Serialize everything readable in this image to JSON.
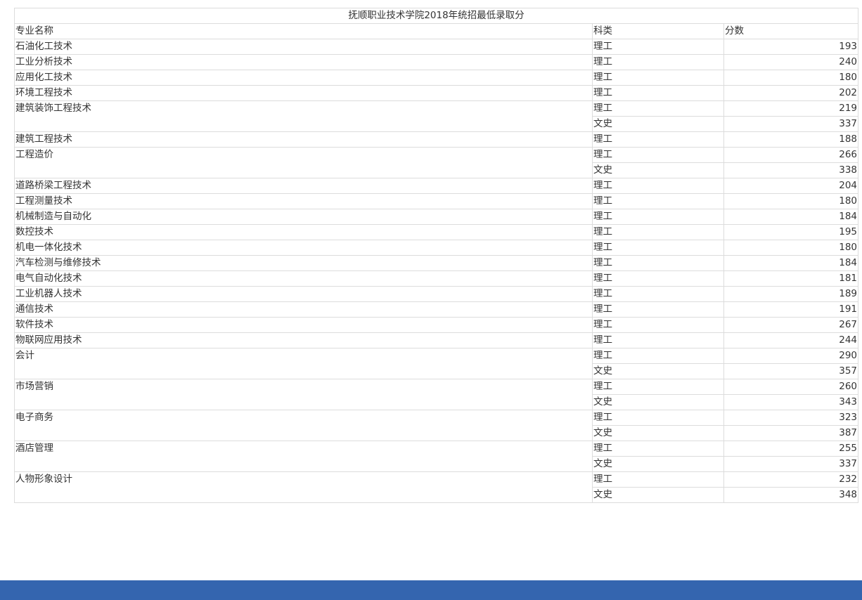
{
  "table": {
    "title": "抚顺职业技术学院2018年统招最低录取分",
    "headers": {
      "major": "专业名称",
      "type": "科类",
      "score": "分数"
    },
    "groups": [
      {
        "major": "石油化工技术",
        "rows": [
          {
            "type": "理工",
            "score": "193"
          }
        ]
      },
      {
        "major": "工业分析技术",
        "rows": [
          {
            "type": "理工",
            "score": "240"
          }
        ]
      },
      {
        "major": "应用化工技术",
        "rows": [
          {
            "type": "理工",
            "score": "180"
          }
        ]
      },
      {
        "major": "环境工程技术",
        "rows": [
          {
            "type": "理工",
            "score": "202"
          }
        ]
      },
      {
        "major": "建筑装饰工程技术",
        "rows": [
          {
            "type": "理工",
            "score": "219"
          },
          {
            "type": "文史",
            "score": "337"
          }
        ]
      },
      {
        "major": "建筑工程技术",
        "rows": [
          {
            "type": "理工",
            "score": "188"
          }
        ]
      },
      {
        "major": "工程造价",
        "rows": [
          {
            "type": "理工",
            "score": "266"
          },
          {
            "type": "文史",
            "score": "338"
          }
        ]
      },
      {
        "major": "道路桥梁工程技术",
        "rows": [
          {
            "type": "理工",
            "score": "204"
          }
        ]
      },
      {
        "major": "工程测量技术",
        "rows": [
          {
            "type": "理工",
            "score": "180"
          }
        ]
      },
      {
        "major": "机械制造与自动化",
        "rows": [
          {
            "type": "理工",
            "score": "184"
          }
        ]
      },
      {
        "major": "数控技术",
        "rows": [
          {
            "type": "理工",
            "score": "195"
          }
        ]
      },
      {
        "major": "机电一体化技术",
        "rows": [
          {
            "type": "理工",
            "score": "180"
          }
        ]
      },
      {
        "major": "汽车检测与维修技术",
        "rows": [
          {
            "type": "理工",
            "score": "184"
          }
        ]
      },
      {
        "major": "电气自动化技术",
        "rows": [
          {
            "type": "理工",
            "score": "181"
          }
        ]
      },
      {
        "major": "工业机器人技术",
        "rows": [
          {
            "type": "理工",
            "score": "189"
          }
        ]
      },
      {
        "major": "通信技术",
        "rows": [
          {
            "type": "理工",
            "score": "191"
          }
        ]
      },
      {
        "major": "软件技术",
        "rows": [
          {
            "type": "理工",
            "score": "267"
          }
        ]
      },
      {
        "major": "物联网应用技术",
        "rows": [
          {
            "type": "理工",
            "score": "244"
          }
        ]
      },
      {
        "major": "会计",
        "rows": [
          {
            "type": "理工",
            "score": "290"
          },
          {
            "type": "文史",
            "score": "357"
          }
        ]
      },
      {
        "major": "市场营销",
        "rows": [
          {
            "type": "理工",
            "score": "260"
          },
          {
            "type": "文史",
            "score": "343"
          }
        ]
      },
      {
        "major": "电子商务",
        "rows": [
          {
            "type": "理工",
            "score": "323"
          },
          {
            "type": "文史",
            "score": "387"
          }
        ]
      },
      {
        "major": "酒店管理",
        "rows": [
          {
            "type": "理工",
            "score": "255"
          },
          {
            "type": "文史",
            "score": "337"
          }
        ]
      },
      {
        "major": "人物形象设计",
        "rows": [
          {
            "type": "理工",
            "score": "232"
          },
          {
            "type": "文史",
            "score": "348"
          }
        ]
      }
    ]
  },
  "colors": {
    "footer": "#3465af",
    "border": "#dcdcdc",
    "text": "#333333"
  }
}
